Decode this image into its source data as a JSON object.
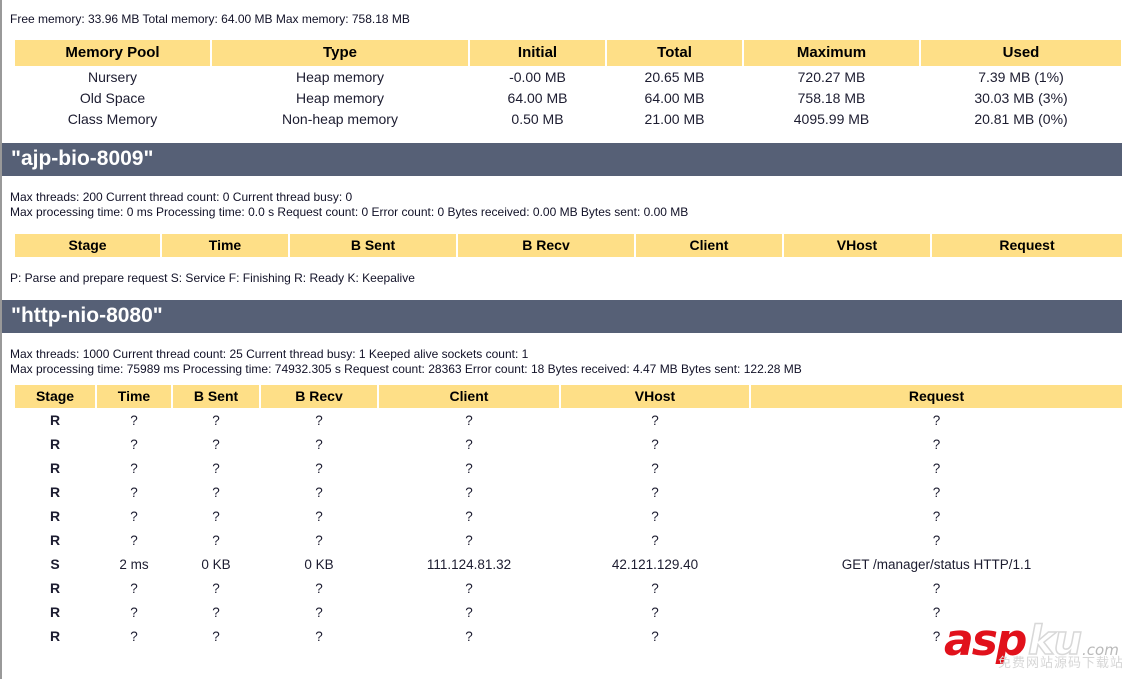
{
  "memory_summary": "Free memory: 33.96 MB Total memory: 64.00 MB Max memory: 758.18 MB",
  "memory_table": {
    "headers": [
      "Memory Pool",
      "Type",
      "Initial",
      "Total",
      "Maximum",
      "Used"
    ],
    "rows": [
      [
        "Nursery",
        "Heap memory",
        "-0.00 MB",
        "20.65 MB",
        "720.27 MB",
        "7.39 MB (1%)"
      ],
      [
        "Old Space",
        "Heap memory",
        "64.00 MB",
        "64.00 MB",
        "758.18 MB",
        "30.03 MB (3%)"
      ],
      [
        "Class Memory",
        "Non-heap memory",
        "0.50 MB",
        "21.00 MB",
        "4095.99 MB",
        "20.81 MB (0%)"
      ]
    ]
  },
  "stage_legend": "P: Parse and prepare request S: Service F: Finishing R: Ready K: Keepalive",
  "connectors": [
    {
      "name": "\"ajp-bio-8009\"",
      "threads_line": "Max threads: 200 Current thread count: 0 Current thread busy: 0",
      "requests_line": "Max processing time: 0 ms Processing time: 0.0 s Request count: 0 Error count: 0 Bytes received: 0.00 MB Bytes sent: 0.00 MB",
      "headers": [
        "Stage",
        "Time",
        "B Sent",
        "B Recv",
        "Client",
        "VHost",
        "Request"
      ],
      "rows": []
    },
    {
      "name": "\"http-nio-8080\"",
      "threads_line": "Max threads: 1000 Current thread count: 25 Current thread busy: 1 Keeped alive sockets count: 1",
      "requests_line": "Max processing time: 75989 ms Processing time: 74932.305 s Request count: 28363 Error count: 18 Bytes received: 4.47 MB Bytes sent: 122.28 MB",
      "headers": [
        "Stage",
        "Time",
        "B Sent",
        "B Recv",
        "Client",
        "VHost",
        "Request"
      ],
      "rows": [
        [
          "R",
          "?",
          "?",
          "?",
          "?",
          "?",
          "?"
        ],
        [
          "R",
          "?",
          "?",
          "?",
          "?",
          "?",
          "?"
        ],
        [
          "R",
          "?",
          "?",
          "?",
          "?",
          "?",
          "?"
        ],
        [
          "R",
          "?",
          "?",
          "?",
          "?",
          "?",
          "?"
        ],
        [
          "R",
          "?",
          "?",
          "?",
          "?",
          "?",
          "?"
        ],
        [
          "R",
          "?",
          "?",
          "?",
          "?",
          "?",
          "?"
        ],
        [
          "S",
          "2 ms",
          "0 KB",
          "0 KB",
          "111.124.81.32",
          "42.121.129.40",
          "GET /manager/status HTTP/1.1"
        ],
        [
          "R",
          "?",
          "?",
          "?",
          "?",
          "?",
          "?"
        ],
        [
          "R",
          "?",
          "?",
          "?",
          "?",
          "?",
          "?"
        ],
        [
          "R",
          "?",
          "?",
          "?",
          "?",
          "?",
          "?"
        ]
      ]
    }
  ],
  "watermark": {
    "primary": "asp",
    "secondary": "ku",
    "tld": ".com",
    "subtitle": "免费网站源码下载站!"
  },
  "colors": {
    "table_header_bg": "#FEDF87",
    "connector_bar_bg": "#566076",
    "text": "#111127",
    "watermark_red": "#E1111B"
  }
}
